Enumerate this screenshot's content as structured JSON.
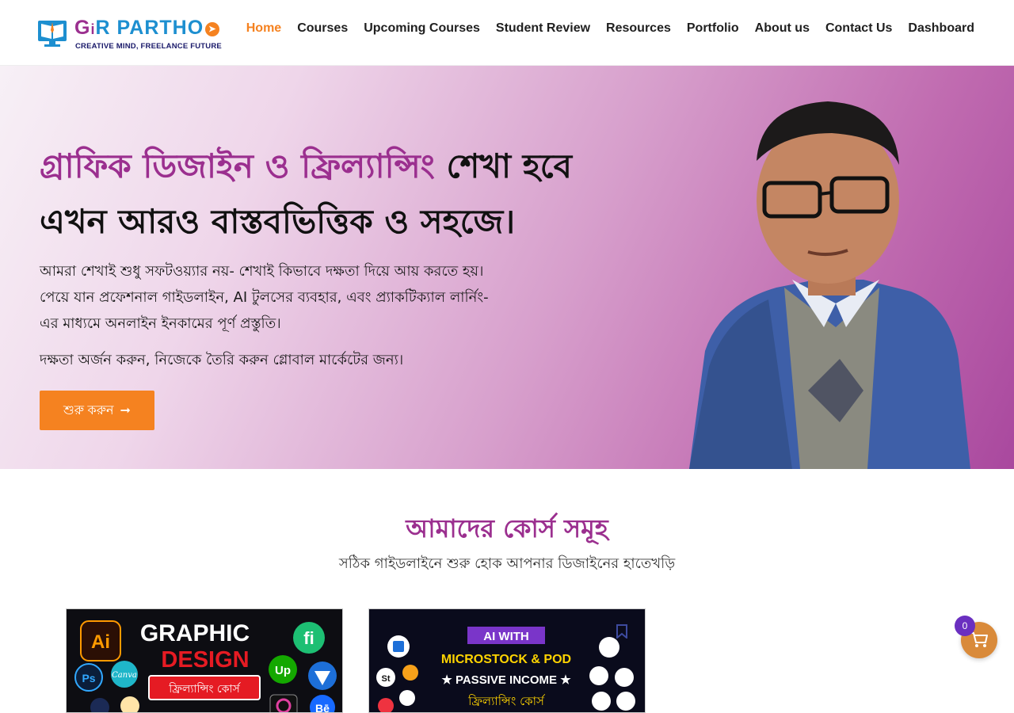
{
  "brand": {
    "name_part1": "G",
    "name_part2": "R PARTH",
    "name_dot": "O",
    "tagline": "CREATIVE MIND, FREELANCE FUTURE",
    "color_primary": "#9b2f8f",
    "color_secondary": "#1d8fd0",
    "color_accent": "#f58220"
  },
  "nav": {
    "items": [
      {
        "label": "Home",
        "active": true
      },
      {
        "label": "Courses"
      },
      {
        "label": "Upcoming Courses"
      },
      {
        "label": "Student Review"
      },
      {
        "label": "Resources"
      },
      {
        "label": "Portfolio"
      },
      {
        "label": "About us"
      },
      {
        "label": "Contact Us"
      },
      {
        "label": "Dashboard"
      }
    ]
  },
  "hero": {
    "title_highlight": "গ্রাফিক ডিজাইন ও ফ্রিল্যান্সিং",
    "title_rest": " শেখা হবে এখন আরও বাস্তবভিত্তিক ও সহজে।",
    "description": "আমরা শেখাই শুধু সফটওয়্যার নয়- শেখাই কিভাবে দক্ষতা দিয়ে আয় করতে হয়। পেয়ে যান প্রফেশনাল গাইডলাইন, AI টুলসের ব্যবহার, এবং প্র্যাকটিক্যাল লার্নিং-এর মাধ্যমে অনলাইন ইনকামের পূর্ণ প্রস্তুতি।",
    "subtext": "দক্ষতা অর্জন করুন, নিজেকে তৈরি করুন গ্লোবাল মার্কেটের জন্য।",
    "cta_label": "শুরু করুন",
    "cta_icon": "arrow-right-icon"
  },
  "courses": {
    "title": "আমাদের কোর্স সমূহ",
    "subtitle": "সঠিক গাইডলাইনে শুরু হোক আপনার ডিজাইনের হাতেখড়ি",
    "cards": [
      {
        "line1": "GRAPHIC",
        "line2": "DESIGN",
        "badge": "ফ্রিল্যান্সিং কোর্স"
      },
      {
        "line1": "AI WITH",
        "line2": "MICROSTOCK & POD",
        "line3": "★ PASSIVE INCOME ★",
        "badge": "ফ্রিল্যান্সিং কোর্স"
      }
    ]
  },
  "cart": {
    "count": "0",
    "icon": "cart-icon"
  }
}
